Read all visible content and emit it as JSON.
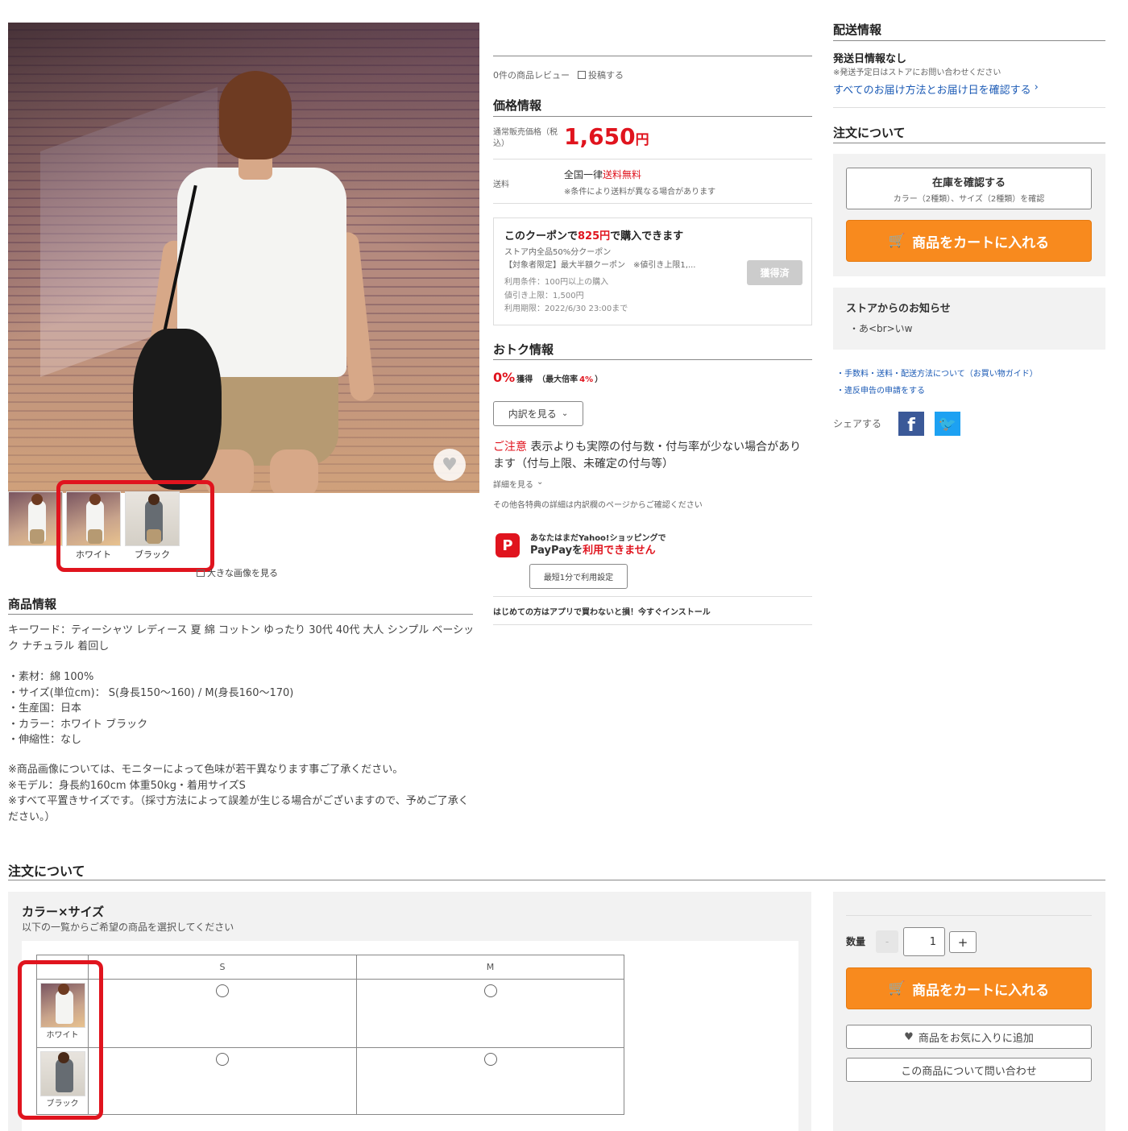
{
  "product_info": {
    "thumb_labels": [
      "ホワイト",
      "ブラック"
    ],
    "enlarge_link": "大きな画像を見る",
    "heading": "商品情報",
    "keywords": "キーワード：ティーシャツ レディース 夏 綿 コットン ゆったり 30代 40代 大人 シンプル ベーシック ナチュラル 着回し",
    "specs": [
      "・素材：綿 100%",
      "・サイズ(単位cm)： S(身長150～160) / M(身長160～170)",
      "・生産国：日本",
      "・カラー：ホワイト ブラック",
      "・伸縮性：なし"
    ],
    "notes": [
      "※商品画像については、モニターによって色味が若干異なります事ご了承ください。",
      "※モデル：身長約160cm 体重50kg・着用サイズS",
      "※すべて平置きサイズです。（採寸方法によって誤差が生じる場合がございますので、予めご了承ください。）"
    ]
  },
  "review": {
    "count_text": "0件の商品レビュー",
    "post_link": "投稿する"
  },
  "price_info": {
    "heading": "価格情報",
    "normal_label": "通常販売価格（税込）",
    "price": "1,650",
    "unit": "円",
    "shipping_label": "送料",
    "shipping_prefix": "全国一律",
    "shipping_free": "送料無料",
    "shipping_note": "※条件により送料が異なる場合があります"
  },
  "coupon": {
    "title_pre": "このクーポンで",
    "title_amount": "825円",
    "title_post": "で購入できます",
    "line1": "ストア内全品50%分クーポン",
    "line2": "【対象者限定】最大半額クーポン　※値引き上限1,...",
    "cond1": "利用条件：100円以上の購入",
    "cond2": "値引き上限：1,500円",
    "cond3": "利用期限：2022/6/30 23:00まで",
    "button": "獲得済"
  },
  "deals": {
    "heading": "おトク情報",
    "rate": "0%",
    "rate_suffix": "獲得",
    "max_pre": "（最大倍率",
    "max_rate": "4%",
    "max_post": "）",
    "breakdown_button": "内訳を見る",
    "caution_label": "ご注意",
    "caution_text": "表示よりも実際の付与数・付与率が少ない場合があります（付与上限、未確定の付与等）",
    "details_link": "詳細を見る",
    "other_note": "その他各特典の詳細は内訳欄のページからご確認ください",
    "paypay_line1": "あなたはまだYahoo!ショッピングで",
    "paypay_pre": "PayPayを",
    "paypay_red": "利用できません",
    "paypay_button": "最短1分で利用設定",
    "app_banner": "はじめての方はアプリで買わないと損！今すぐインストール"
  },
  "delivery": {
    "heading": "配送情報",
    "ship_date": "発送日情報なし",
    "ship_note": "※発送予定日はストアにお問い合わせください",
    "all_methods_link": "すべてのお届け方法とお届け日を確認する"
  },
  "order_side": {
    "heading": "注文について",
    "stock_button_title": "在庫を確認する",
    "stock_button_sub": "カラー（2種類）、サイズ（2種類）を確認",
    "cart_button": "商品をカートに入れる",
    "notice_heading": "ストアからのお知らせ",
    "notice_text": "・あ<br>いw",
    "guide_link": "・手数料・送料・配送方法について（お買い物ガイド）",
    "report_link": "・違反申告の申請をする",
    "share_label": "シェアする"
  },
  "order_bottom": {
    "heading": "注文について",
    "option_title": "カラー×サイズ",
    "option_sub": "以下の一覧からご希望の商品を選択してください",
    "sizes": [
      "S",
      "M"
    ],
    "colors": [
      "ホワイト",
      "ブラック"
    ],
    "qty_label": "数量",
    "qty_value": "1",
    "qty_minus": "-",
    "qty_plus": "+",
    "cart_button": "商品をカートに入れる",
    "favorite_button": "商品をお気に入りに追加",
    "inquiry_button": "この商品について問い合わせ"
  },
  "colors": {
    "accent_red": "#e0141e",
    "cart_orange": "#f88a1e",
    "link_blue": "#1b5ab5",
    "facebook": "#3b5998",
    "twitter": "#1da1f2"
  }
}
